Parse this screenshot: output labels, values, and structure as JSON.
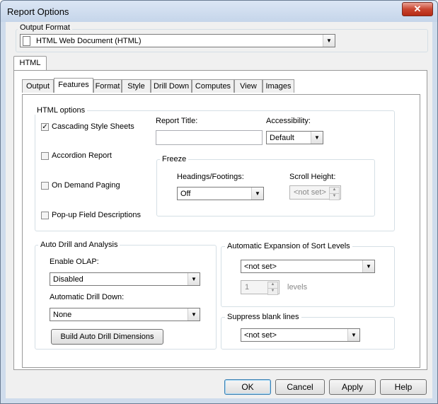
{
  "window": {
    "title": "Report Options",
    "close_glyph": "✕"
  },
  "output_format": {
    "label": "Output Format",
    "value": "HTML Web Document (HTML)",
    "icon": "document-icon"
  },
  "main_tab": "HTML",
  "tabs": [
    "Output",
    "Features",
    "Format",
    "Style",
    "Drill Down",
    "Computes",
    "View",
    "Images"
  ],
  "active_tab": "Features",
  "html_options": {
    "label": "HTML options",
    "cascading_style_sheets": {
      "label": "Cascading Style Sheets",
      "checked": true
    },
    "accordion_report": {
      "label": "Accordion Report",
      "checked": false
    },
    "on_demand_paging": {
      "label": "On Demand Paging",
      "checked": false
    },
    "popup_field_descriptions": {
      "label": "Pop-up Field Descriptions",
      "checked": false
    },
    "report_title": {
      "label": "Report Title:",
      "value": ""
    },
    "accessibility": {
      "label": "Accessibility:",
      "value": "Default"
    },
    "freeze": {
      "label": "Freeze",
      "headings_footings": {
        "label": "Headings/Footings:",
        "value": "Off"
      },
      "scroll_height": {
        "label": "Scroll Height:",
        "value": "<not set>"
      }
    }
  },
  "auto_drill": {
    "label": "Auto Drill and Analysis",
    "enable_olap": {
      "label": "Enable OLAP:",
      "value": "Disabled"
    },
    "automatic_drill_down": {
      "label": "Automatic Drill Down:",
      "value": "None"
    },
    "build_button": "Build Auto Drill Dimensions"
  },
  "sort_expansion": {
    "label": "Automatic Expansion of Sort Levels",
    "value": "<not set>",
    "levels_value": "1",
    "levels_label": "levels"
  },
  "suppress_blank": {
    "label": "Suppress blank lines",
    "value": "<not set>"
  },
  "buttons": {
    "ok": "OK",
    "cancel": "Cancel",
    "apply": "Apply",
    "help": "Help"
  }
}
